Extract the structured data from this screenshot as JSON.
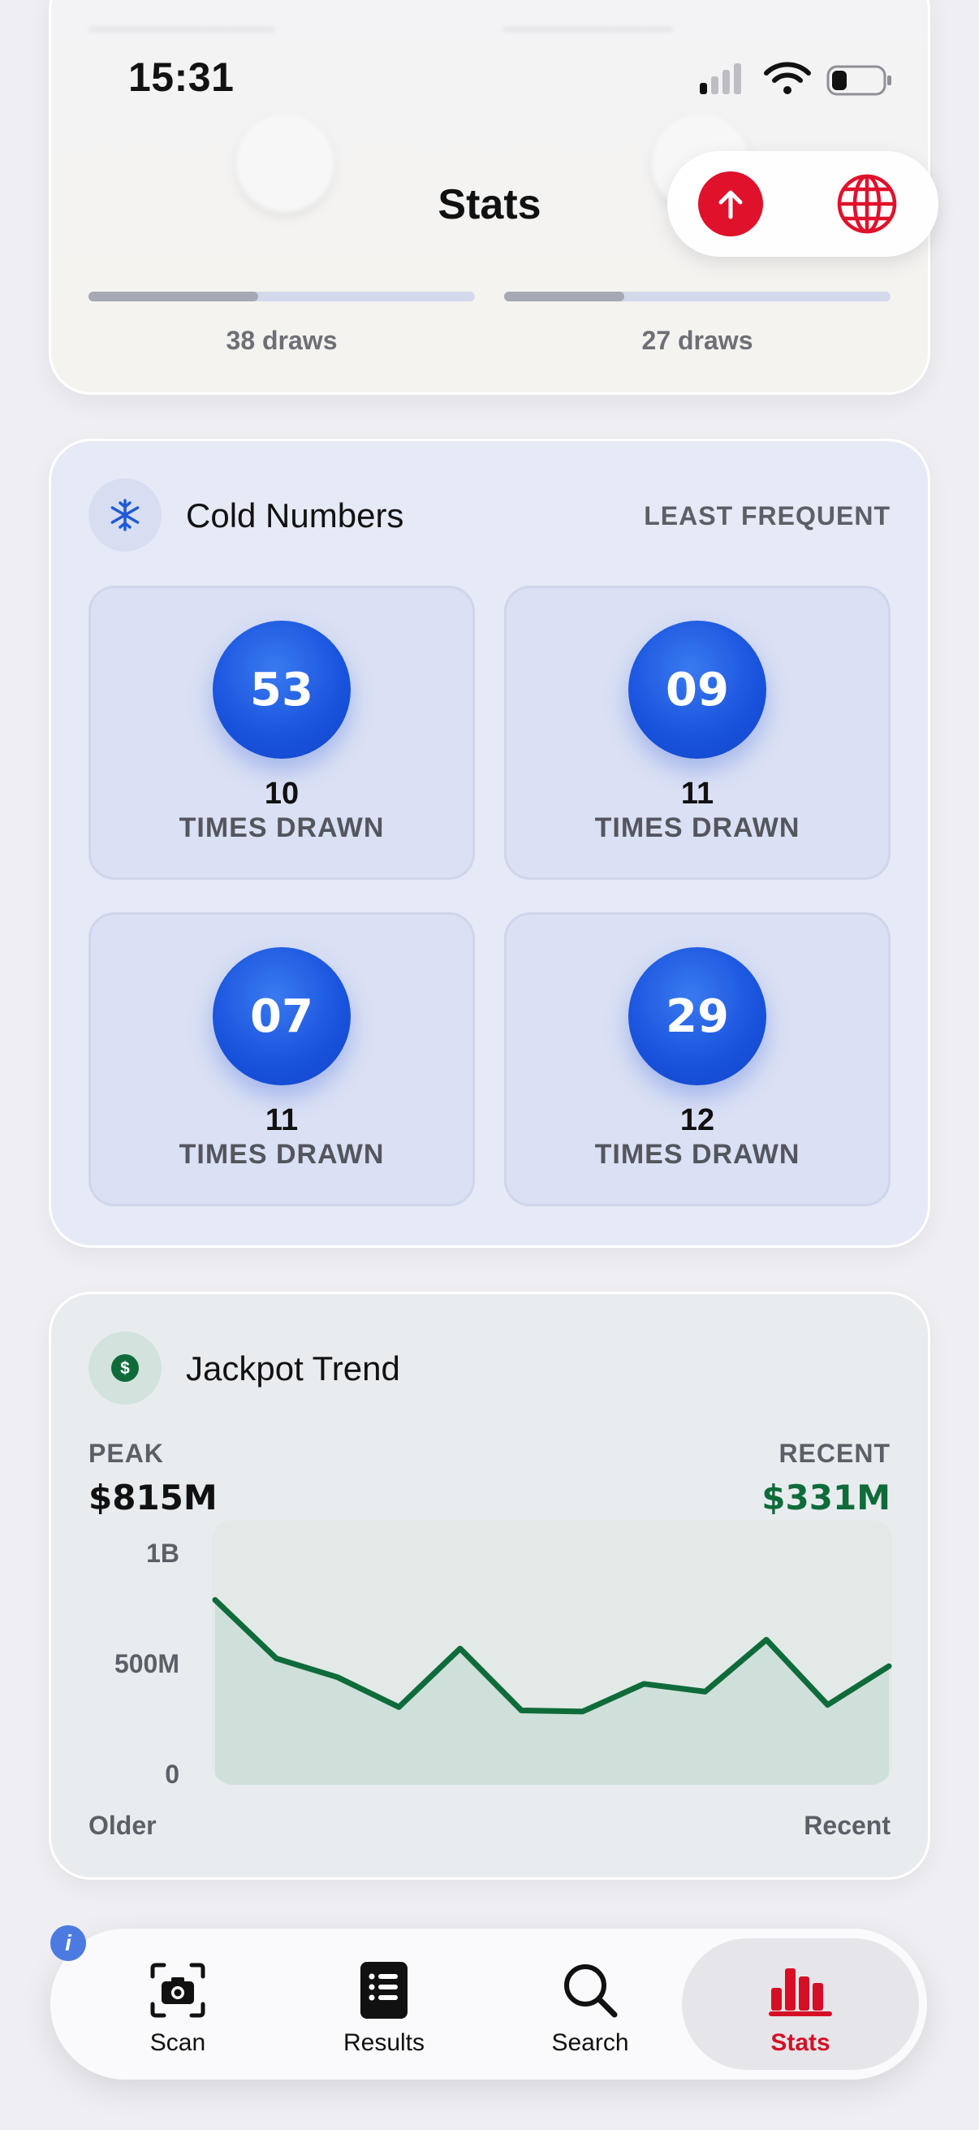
{
  "status_bar": {
    "time": "15:31",
    "battery_level": 0.3
  },
  "nav": {
    "title": "Stats",
    "actions": [
      "upload-icon",
      "globe-icon"
    ],
    "accent": "#e0112b"
  },
  "hot_numbers": {
    "columns": [
      {
        "draws_label": "38 draws",
        "progress": 0.44
      },
      {
        "draws_label": "27 draws",
        "progress": 0.31
      }
    ]
  },
  "cold_numbers": {
    "title": "Cold Numbers",
    "tag": "LEAST FREQUENT",
    "icon": "snowflake-icon",
    "unit_label": "TIMES DRAWN",
    "ball_color": "#1a55de",
    "items": [
      {
        "number": "53",
        "count": "10"
      },
      {
        "number": "09",
        "count": "11"
      },
      {
        "number": "07",
        "count": "11"
      },
      {
        "number": "29",
        "count": "12"
      }
    ]
  },
  "jackpot_trend": {
    "title": "Jackpot Trend",
    "icon": "dollar-icon",
    "peak_label": "PEAK",
    "peak_value": "$815M",
    "recent_label": "RECENT",
    "recent_value": "$331M",
    "recent_color": "#0f6b3a",
    "x_start_label": "Older",
    "x_end_label": "Recent"
  },
  "chart_data": {
    "type": "area",
    "ytick_labels": [
      "1B",
      "500M",
      "0"
    ],
    "ylim": [
      0,
      1000
    ],
    "y_unit": "M",
    "grid": false,
    "x": [
      1,
      2,
      3,
      4,
      5,
      6,
      7,
      8,
      9,
      10,
      11,
      12
    ],
    "series": [
      {
        "values": [
          785,
          520,
          435,
          300,
          565,
          285,
          280,
          405,
          370,
          605,
          310,
          485
        ]
      }
    ],
    "line_color": "#0f6b3a",
    "fill_color": "#cfe0da"
  },
  "tabbar": {
    "info_badge": "i",
    "tabs": [
      {
        "label": "Scan",
        "icon": "camera-scan-icon"
      },
      {
        "label": "Results",
        "icon": "list-icon"
      },
      {
        "label": "Search",
        "icon": "search-icon"
      },
      {
        "label": "Stats",
        "icon": "bar-chart-icon",
        "active": true
      }
    ],
    "active_color": "#d50f25"
  }
}
